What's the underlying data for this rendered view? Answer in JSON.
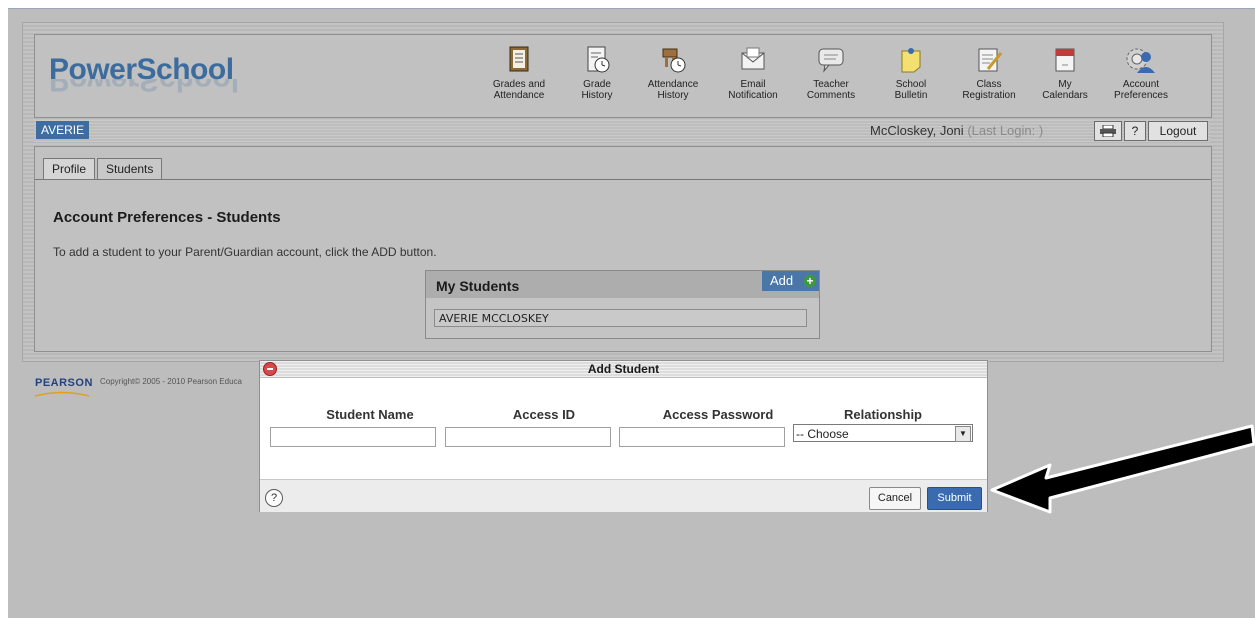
{
  "app": {
    "logo": "PowerSchool"
  },
  "nav": {
    "items": [
      {
        "label_line1": "Grades and",
        "label_line2": "Attendance",
        "icon": "gradebook-icon"
      },
      {
        "label_line1": "Grade",
        "label_line2": "History",
        "icon": "grade-history-icon"
      },
      {
        "label_line1": "Attendance",
        "label_line2": "History",
        "icon": "attendance-history-icon"
      },
      {
        "label_line1": "Email",
        "label_line2": "Notification",
        "icon": "envelope-icon"
      },
      {
        "label_line1": "Teacher",
        "label_line2": "Comments",
        "icon": "speech-bubble-icon"
      },
      {
        "label_line1": "School",
        "label_line2": "Bulletin",
        "icon": "sticky-note-icon"
      },
      {
        "label_line1": "Class",
        "label_line2": "Registration",
        "icon": "pencil-note-icon"
      },
      {
        "label_line1": "My",
        "label_line2": "Calendars",
        "icon": "calendar-icon"
      },
      {
        "label_line1": "Account",
        "label_line2": "Preferences",
        "icon": "account-gear-icon"
      }
    ]
  },
  "userbar": {
    "student_tab": "AVERIE",
    "user_name": "McCloskey, Joni",
    "last_login": "(Last Login: )",
    "help_label": "?",
    "logout_label": "Logout"
  },
  "tabs": [
    {
      "label": "Profile"
    },
    {
      "label": "Students"
    }
  ],
  "main": {
    "title": "Account Preferences - Students",
    "instruction": "To add a student to your Parent/Guardian account, click the ADD button."
  },
  "students_panel": {
    "title": "My Students",
    "add_label": "Add",
    "students": [
      "AVERIE MCCLOSKEY"
    ]
  },
  "footer": {
    "logo": "PEARSON",
    "copyright": "Copyright© 2005 - 2010 Pearson Educa"
  },
  "dialog": {
    "title": "Add Student",
    "columns": {
      "student_name": "Student Name",
      "access_id": "Access ID",
      "access_password": "Access Password",
      "relationship": "Relationship"
    },
    "fields": {
      "student_name": "",
      "access_id": "",
      "access_password": ""
    },
    "relationship_selected": "-- Choose",
    "help_label": "?",
    "cancel_label": "Cancel",
    "submit_label": "Submit"
  },
  "colors": {
    "brand_blue": "#3c6c9e",
    "submit_blue": "#3a6ab0"
  }
}
